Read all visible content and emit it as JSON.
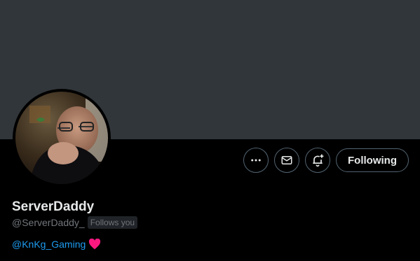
{
  "profile": {
    "display_name": "ServerDaddy",
    "handle": "@ServerDaddy_",
    "follows_you_badge": "Follows you",
    "bio_mention": "@KnKg_Gaming",
    "bio_emoji": "heart-icon"
  },
  "actions": {
    "following_label": "Following",
    "more_icon": "more-horizontal-icon",
    "message_icon": "envelope-icon",
    "notify_icon": "bell-plus-icon"
  },
  "colors": {
    "banner": "#31363a",
    "background": "#000000",
    "text_primary": "#e7e9ea",
    "text_secondary": "#71767b",
    "link": "#1d9bf0",
    "heart": "#f91880"
  }
}
